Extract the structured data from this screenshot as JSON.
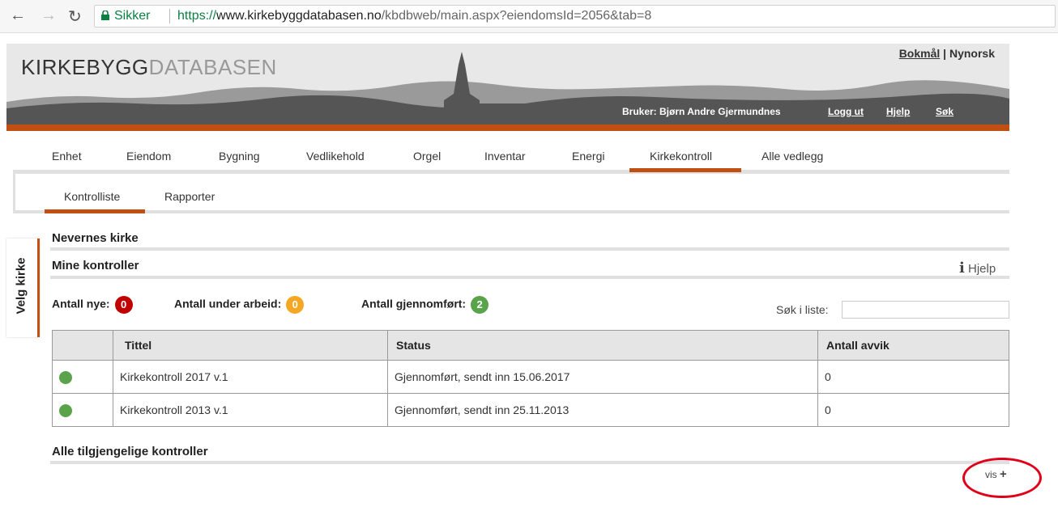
{
  "browser": {
    "secure_label": "Sikker",
    "url_scheme": "https://",
    "url_domain": "www.kirkebyggdatabasen.no",
    "url_path": "/kbdbweb/main.aspx?eiendomsId=2056&tab=8"
  },
  "header": {
    "logo_a": "KIRKEBYGG",
    "logo_b": "DATABASEN",
    "lang_bokmal": "Bokmål",
    "lang_sep": " | ",
    "lang_nynorsk": "Nynorsk",
    "user": "Bruker: Bjørn Andre Gjermundnes",
    "logout": "Logg ut",
    "help": "Hjelp",
    "search": "Søk"
  },
  "tabs": [
    "Enhet",
    "Eiendom",
    "Bygning",
    "Vedlikehold",
    "Orgel",
    "Inventar",
    "Energi",
    "Kirkekontroll",
    "Alle vedlegg"
  ],
  "subtabs": [
    "Kontrolliste",
    "Rapporter"
  ],
  "side": {
    "label": "Velg kirke"
  },
  "main": {
    "church": "Nevernes kirke",
    "mine": "Mine kontroller",
    "help": "Hjelp",
    "counts": [
      {
        "label": "Antall nye:",
        "value": "0",
        "color": "#c00000"
      },
      {
        "label": "Antall under arbeid:",
        "value": "0",
        "color": "#f5a623"
      },
      {
        "label": "Antall gjennomført:",
        "value": "2",
        "color": "#5ba34a"
      }
    ],
    "search_label": "Søk i liste:",
    "table": {
      "headers": [
        "",
        "Tittel",
        "Status",
        "Antall avvik"
      ],
      "rows": [
        {
          "title": "Kirkekontroll 2017 v.1",
          "status": "Gjennomført, sendt inn 15.06.2017",
          "avvik": "0"
        },
        {
          "title": "Kirkekontroll 2013 v.1",
          "status": "Gjennomført, sendt inn 25.11.2013",
          "avvik": "0"
        }
      ]
    },
    "all": "Alle tilgjengelige kontroller",
    "vis": "vis",
    "vis_icon": "+"
  }
}
